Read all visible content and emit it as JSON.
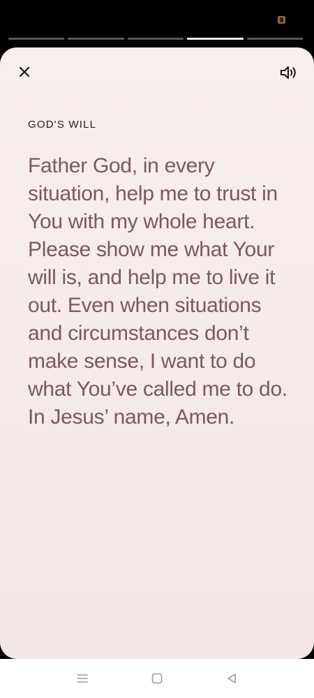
{
  "story": {
    "segments": 5,
    "active_segment": 4
  },
  "header": {
    "close_icon": "close-icon",
    "sound_icon": "speaker-icon"
  },
  "content": {
    "title": "GOD'S WILL",
    "body": "Father God, in every situation, help me to trust in You with my whole heart. Please show me what Your will is, and help me to live it out. Even when situations and circumstances don’t make sense, I want to do what You’ve called me to do. In Jesus’ name, Amen."
  },
  "colors": {
    "card_background": "#f8ecec",
    "body_text": "#7a5a58",
    "title_text": "#2a2020"
  },
  "system_nav": {
    "menu_icon": "menu-icon",
    "home_icon": "home-icon",
    "back_icon": "back-icon"
  }
}
